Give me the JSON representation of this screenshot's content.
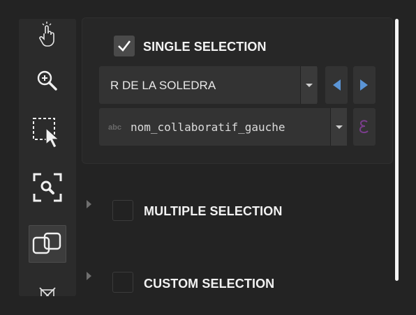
{
  "toolbar": {
    "tools": [
      {
        "icon": "pointer-hand-icon"
      },
      {
        "icon": "zoom-icon"
      },
      {
        "icon": "selection-arrow-icon"
      },
      {
        "icon": "zoom-to-selection-icon"
      },
      {
        "icon": "linked-selection-icon",
        "active": true
      },
      {
        "icon": "clear-selection-icon"
      }
    ]
  },
  "sections": {
    "single": {
      "label": "SINGLE SELECTION",
      "checked": true,
      "expanded": true
    },
    "multiple": {
      "label": "MULTIPLE SELECTION",
      "checked": false,
      "expanded": false
    },
    "custom": {
      "label": "CUSTOM SELECTION",
      "checked": false,
      "expanded": false
    }
  },
  "single_selection": {
    "value_dropdown": {
      "value": "R DE LA SOLEDRA"
    },
    "field_dropdown": {
      "type_badge": "abc",
      "value": "nom_collaboratif_gauche"
    }
  },
  "colors": {
    "background": "#232323",
    "nav_arrow": "#5b95d6",
    "expression_icon": "#7a3d8c"
  }
}
